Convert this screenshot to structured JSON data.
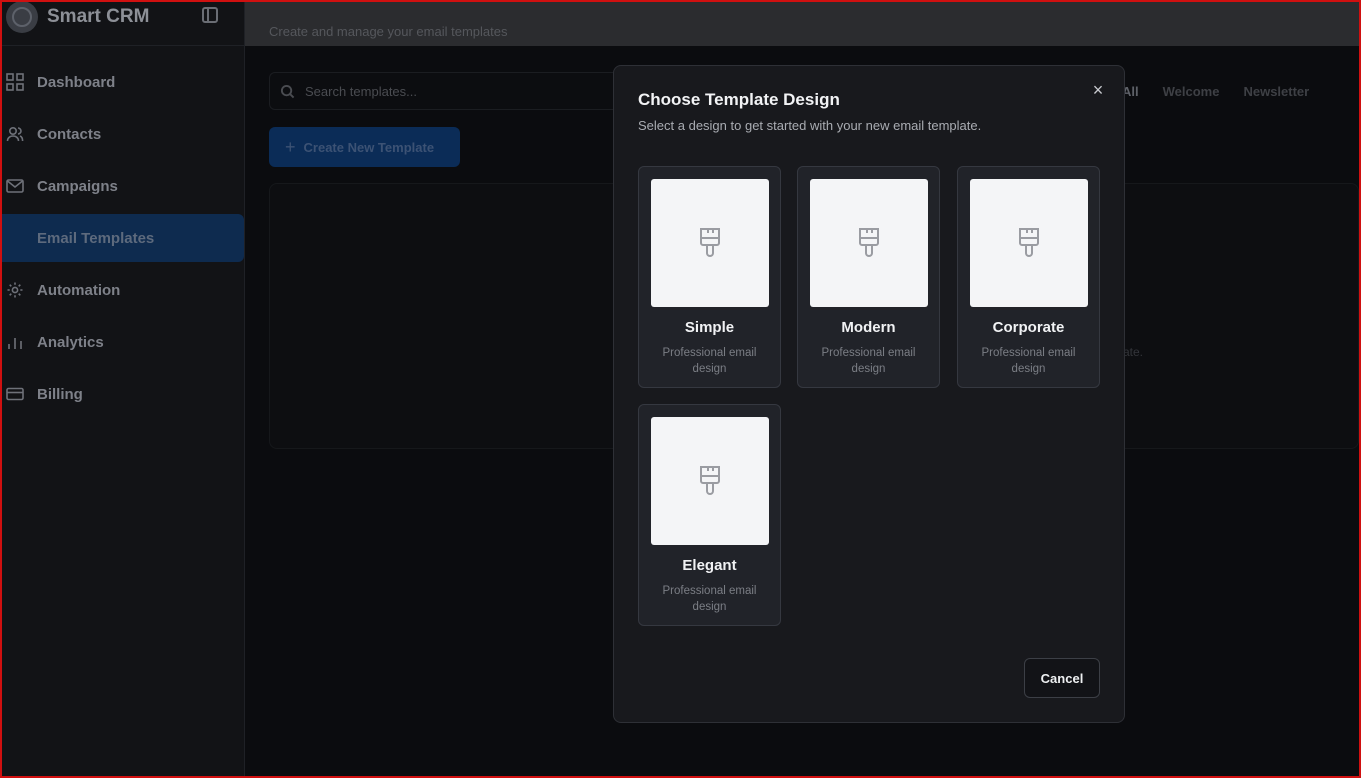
{
  "app": {
    "name": "Smart CRM"
  },
  "sidebar": {
    "items": [
      {
        "label": "Dashboard",
        "icon": "grid-icon"
      },
      {
        "label": "Contacts",
        "icon": "users-icon"
      },
      {
        "label": "Campaigns",
        "icon": "mail-icon"
      },
      {
        "label": "Email Templates",
        "icon": "file-icon",
        "active": true
      },
      {
        "label": "Automation",
        "icon": "gear-icon"
      },
      {
        "label": "Analytics",
        "icon": "bar-chart-icon"
      },
      {
        "label": "Billing",
        "icon": "credit-card-icon"
      }
    ]
  },
  "main": {
    "subtitle": "Create and manage your email templates",
    "search_placeholder": "Search templates...",
    "create_button": "Create New Template",
    "filters": [
      "All",
      "Welcome",
      "Newsletter"
    ],
    "empty_hint": "ate."
  },
  "modal": {
    "title": "Choose Template Design",
    "description": "Select a design to get started with your new email template.",
    "close": "×",
    "designs": [
      {
        "name": "Simple",
        "desc": "Professional email design"
      },
      {
        "name": "Modern",
        "desc": "Professional email design"
      },
      {
        "name": "Corporate",
        "desc": "Professional email design"
      },
      {
        "name": "Elegant",
        "desc": "Professional email design"
      }
    ],
    "cancel": "Cancel"
  },
  "colors": {
    "modal_bg": "#18191d",
    "card_bg": "#212329",
    "active_nav": "#0e2b4f",
    "frame": "#d01010"
  }
}
